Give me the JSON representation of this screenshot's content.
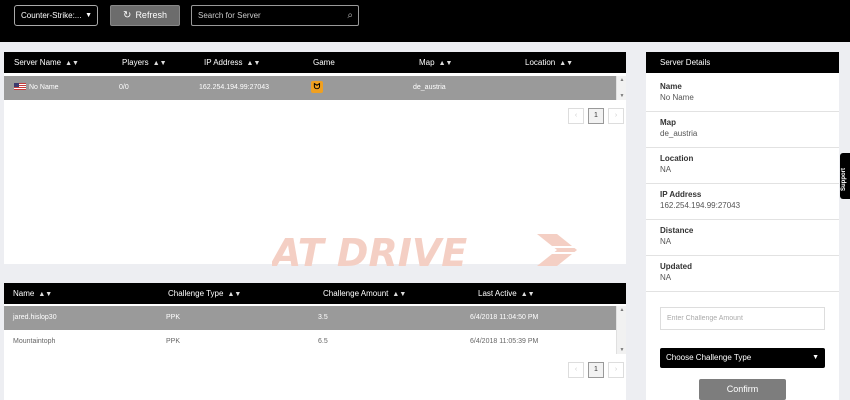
{
  "topbar": {
    "game_select": "Counter-Strike:...",
    "refresh_label": "Refresh",
    "search_placeholder": "Search for Server"
  },
  "servers": {
    "columns": [
      "Server Name",
      "Players",
      "IP Address",
      "Game",
      "Map",
      "Location"
    ],
    "rows": [
      {
        "name": "No Name",
        "flag": "us-flag",
        "players": "0/0",
        "ip": "162.254.194.99:27043",
        "game_icon": "counter-strike-icon",
        "map": "de_austria",
        "location": ""
      }
    ],
    "pager": {
      "current": "1"
    }
  },
  "watermark": {
    "text": "AT DRIVE",
    "color": "#f4cfc4"
  },
  "challenges": {
    "columns": [
      "Name",
      "Challenge Type",
      "Challenge Amount",
      "Last Active"
    ],
    "rows": [
      {
        "name": "jared.hislop30",
        "type": "PPK",
        "amount": "3.5",
        "last_active": "6/4/2018 11:04:50 PM",
        "selected": true
      },
      {
        "name": "Mountaintoph",
        "type": "PPK",
        "amount": "6.5",
        "last_active": "6/4/2018 11:05:39 PM",
        "selected": false
      }
    ],
    "pager": {
      "current": "1"
    }
  },
  "details": {
    "header": "Server Details",
    "fields": [
      {
        "label": "Name",
        "value": "No Name"
      },
      {
        "label": "Map",
        "value": "de_austria"
      },
      {
        "label": "Location",
        "value": "NA"
      },
      {
        "label": "IP Address",
        "value": "162.254.194.99:27043"
      },
      {
        "label": "Distance",
        "value": "NA"
      },
      {
        "label": "Updated",
        "value": "NA"
      }
    ],
    "amount_placeholder": "Enter Challenge Amount",
    "type_select": "Choose Challenge Type",
    "confirm_label": "Confirm"
  },
  "side_tab": {
    "label": "Support"
  },
  "colors": {
    "header_bg": "#000000",
    "selected_row": "#9a9a9a",
    "page_bg": "#edeef2"
  }
}
